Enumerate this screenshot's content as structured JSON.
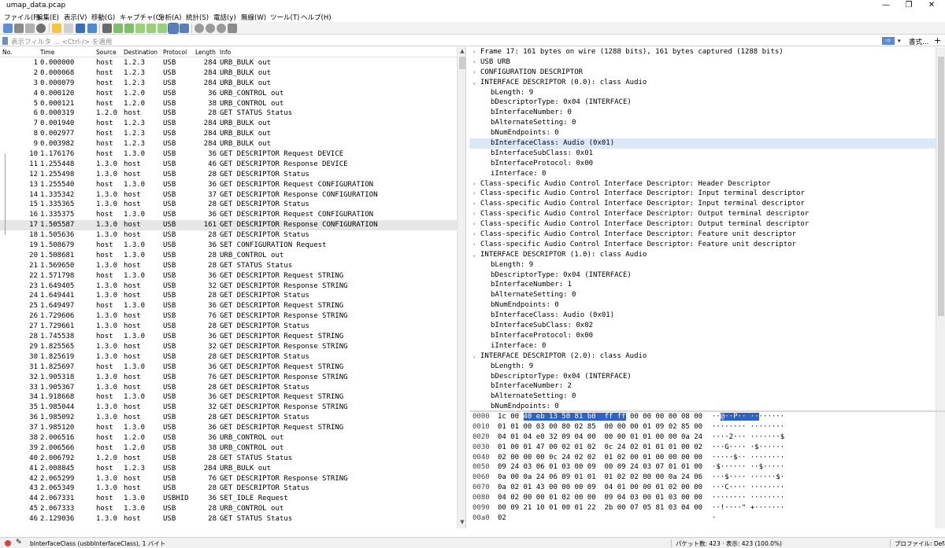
{
  "window": {
    "title": "umap_data.pcap",
    "minimize": "—",
    "restore": "❐",
    "close": "✕"
  },
  "menu": [
    "ファイル(F)",
    "編集(E)",
    "表示(V)",
    "移動(G)",
    "キャプチャ(C)",
    "分析(A)",
    "統計(S)",
    "電話(y)",
    "無線(W)",
    "ツール(T)",
    "ヘルプ(H)"
  ],
  "filter": {
    "placeholder": "表示フィルタ … <Ctrl-/> を適用",
    "apply_glyph": "⇨",
    "dropdown_glyph": "▾",
    "format_label": "書式…",
    "add_glyph": "+"
  },
  "list_columns": [
    "No.",
    "Time",
    "Source",
    "Destination",
    "Protocol",
    "Length",
    "Info"
  ],
  "packets": [
    [
      "1",
      "0.000000",
      "host",
      "1.2.3",
      "USB",
      "284",
      "URB_BULK out"
    ],
    [
      "2",
      "0.000068",
      "host",
      "1.2.3",
      "USB",
      "284",
      "URB_BULK out"
    ],
    [
      "3",
      "0.000079",
      "host",
      "1.2.3",
      "USB",
      "284",
      "URB_BULK out"
    ],
    [
      "4",
      "0.000120",
      "host",
      "1.2.0",
      "USB",
      "36",
      "URB_CONTROL out"
    ],
    [
      "5",
      "0.000121",
      "host",
      "1.2.0",
      "USB",
      "38",
      "URB_CONTROL out"
    ],
    [
      "6",
      "0.000319",
      "1.2.0",
      "host",
      "USB",
      "28",
      "GET STATUS Status"
    ],
    [
      "7",
      "0.001940",
      "host",
      "1.2.3",
      "USB",
      "284",
      "URB_BULK out"
    ],
    [
      "8",
      "0.002977",
      "host",
      "1.2.3",
      "USB",
      "284",
      "URB_BULK out"
    ],
    [
      "9",
      "0.003982",
      "host",
      "1.2.3",
      "USB",
      "284",
      "URB_BULK out"
    ],
    [
      "10",
      "1.176176",
      "host",
      "1.3.0",
      "USB",
      "36",
      "GET DESCRIPTOR Request DEVICE"
    ],
    [
      "11",
      "1.255448",
      "1.3.0",
      "host",
      "USB",
      "46",
      "GET DESCRIPTOR Response DEVICE"
    ],
    [
      "12",
      "1.255498",
      "1.3.0",
      "host",
      "USB",
      "28",
      "GET DESCRIPTOR Status"
    ],
    [
      "13",
      "1.255540",
      "host",
      "1.3.0",
      "USB",
      "36",
      "GET DESCRIPTOR Request CONFIGURATION"
    ],
    [
      "14",
      "1.335342",
      "1.3.0",
      "host",
      "USB",
      "37",
      "GET DESCRIPTOR Response CONFIGURATION"
    ],
    [
      "15",
      "1.335365",
      "1.3.0",
      "host",
      "USB",
      "28",
      "GET DESCRIPTOR Status"
    ],
    [
      "16",
      "1.335375",
      "host",
      "1.3.0",
      "USB",
      "36",
      "GET DESCRIPTOR Request CONFIGURATION"
    ],
    [
      "17",
      "1.505587",
      "1.3.0",
      "host",
      "USB",
      "161",
      "GET DESCRIPTOR Response CONFIGURATION"
    ],
    [
      "18",
      "1.505636",
      "1.3.0",
      "host",
      "USB",
      "28",
      "GET DESCRIPTOR Status"
    ],
    [
      "19",
      "1.508679",
      "host",
      "1.3.0",
      "USB",
      "36",
      "SET CONFIGURATION Request"
    ],
    [
      "20",
      "1.508681",
      "host",
      "1.3.0",
      "USB",
      "28",
      "URB_CONTROL out"
    ],
    [
      "21",
      "1.569650",
      "1.3.0",
      "host",
      "USB",
      "28",
      "GET STATUS Status"
    ],
    [
      "22",
      "1.571798",
      "host",
      "1.3.0",
      "USB",
      "36",
      "GET DESCRIPTOR Request STRING"
    ],
    [
      "23",
      "1.649405",
      "1.3.0",
      "host",
      "USB",
      "32",
      "GET DESCRIPTOR Response STRING"
    ],
    [
      "24",
      "1.649441",
      "1.3.0",
      "host",
      "USB",
      "28",
      "GET DESCRIPTOR Status"
    ],
    [
      "25",
      "1.649497",
      "host",
      "1.3.0",
      "USB",
      "36",
      "GET DESCRIPTOR Request STRING"
    ],
    [
      "26",
      "1.729606",
      "1.3.0",
      "host",
      "USB",
      "76",
      "GET DESCRIPTOR Response STRING"
    ],
    [
      "27",
      "1.729661",
      "1.3.0",
      "host",
      "USB",
      "28",
      "GET DESCRIPTOR Status"
    ],
    [
      "28",
      "1.745538",
      "host",
      "1.3.0",
      "USB",
      "36",
      "GET DESCRIPTOR Request STRING"
    ],
    [
      "29",
      "1.825565",
      "1.3.0",
      "host",
      "USB",
      "32",
      "GET DESCRIPTOR Response STRING"
    ],
    [
      "30",
      "1.825619",
      "1.3.0",
      "host",
      "USB",
      "28",
      "GET DESCRIPTOR Status"
    ],
    [
      "31",
      "1.825697",
      "host",
      "1.3.0",
      "USB",
      "36",
      "GET DESCRIPTOR Request STRING"
    ],
    [
      "32",
      "1.905318",
      "1.3.0",
      "host",
      "USB",
      "76",
      "GET DESCRIPTOR Response STRING"
    ],
    [
      "33",
      "1.905367",
      "1.3.0",
      "host",
      "USB",
      "28",
      "GET DESCRIPTOR Status"
    ],
    [
      "34",
      "1.918668",
      "host",
      "1.3.0",
      "USB",
      "36",
      "GET DESCRIPTOR Request STRING"
    ],
    [
      "35",
      "1.985044",
      "1.3.0",
      "host",
      "USB",
      "32",
      "GET DESCRIPTOR Response STRING"
    ],
    [
      "36",
      "1.985092",
      "1.3.0",
      "host",
      "USB",
      "28",
      "GET DESCRIPTOR Status"
    ],
    [
      "37",
      "1.985120",
      "host",
      "1.3.0",
      "USB",
      "36",
      "GET DESCRIPTOR Request STRING"
    ],
    [
      "38",
      "2.006516",
      "host",
      "1.2.0",
      "USB",
      "36",
      "URB_CONTROL out"
    ],
    [
      "39",
      "2.006566",
      "host",
      "1.2.0",
      "USB",
      "38",
      "URB_CONTROL out"
    ],
    [
      "40",
      "2.006792",
      "1.2.0",
      "host",
      "USB",
      "28",
      "GET STATUS Status"
    ],
    [
      "41",
      "2.008845",
      "host",
      "1.2.3",
      "USB",
      "284",
      "URB_BULK out"
    ],
    [
      "42",
      "2.065299",
      "1.3.0",
      "host",
      "USB",
      "76",
      "GET DESCRIPTOR Response STRING"
    ],
    [
      "43",
      "2.065349",
      "1.3.0",
      "host",
      "USB",
      "28",
      "GET DESCRIPTOR Status"
    ],
    [
      "44",
      "2.067331",
      "host",
      "1.3.0",
      "USBHID",
      "36",
      "SET_IDLE Request"
    ],
    [
      "45",
      "2.067333",
      "host",
      "1.3.0",
      "USB",
      "28",
      "URB_CONTROL out"
    ],
    [
      "46",
      "2.129036",
      "1.3.0",
      "host",
      "USB",
      "28",
      "GET STATUS Status"
    ]
  ],
  "selected_packet": "17",
  "details": [
    {
      "indent": 0,
      "tw": "›",
      "text": "Frame 17: 161 bytes on wire (1288 bits), 161 bytes captured (1288 bits)"
    },
    {
      "indent": 0,
      "tw": "›",
      "text": "USB URB"
    },
    {
      "indent": 0,
      "tw": "›",
      "text": "CONFIGURATION DESCRIPTOR"
    },
    {
      "indent": 0,
      "tw": "⌄",
      "text": "INTERFACE DESCRIPTOR (0.0): class Audio"
    },
    {
      "indent": 1,
      "tw": "",
      "text": "bLength: 9"
    },
    {
      "indent": 1,
      "tw": "",
      "text": "bDescriptorType: 0x04 (INTERFACE)"
    },
    {
      "indent": 1,
      "tw": "",
      "text": "bInterfaceNumber: 0"
    },
    {
      "indent": 1,
      "tw": "",
      "text": "bAlternateSetting: 0"
    },
    {
      "indent": 1,
      "tw": "",
      "text": "bNumEndpoints: 0"
    },
    {
      "indent": 1,
      "tw": "",
      "text": "bInterfaceClass: Audio (0x01)",
      "selected": true
    },
    {
      "indent": 1,
      "tw": "",
      "text": "bInterfaceSubClass: 0x01"
    },
    {
      "indent": 1,
      "tw": "",
      "text": "bInterfaceProtocol: 0x00"
    },
    {
      "indent": 1,
      "tw": "",
      "text": "iInterface: 0"
    },
    {
      "indent": 0,
      "tw": "›",
      "text": "Class-specific Audio Control Interface Descriptor: Header Descriptor"
    },
    {
      "indent": 0,
      "tw": "›",
      "text": "Class-specific Audio Control Interface Descriptor: Input terminal descriptor"
    },
    {
      "indent": 0,
      "tw": "›",
      "text": "Class-specific Audio Control Interface Descriptor: Input terminal descriptor"
    },
    {
      "indent": 0,
      "tw": "›",
      "text": "Class-specific Audio Control Interface Descriptor: Output terminal descriptor"
    },
    {
      "indent": 0,
      "tw": "›",
      "text": "Class-specific Audio Control Interface Descriptor: Output terminal descriptor"
    },
    {
      "indent": 0,
      "tw": "›",
      "text": "Class-specific Audio Control Interface Descriptor: Feature unit descriptor"
    },
    {
      "indent": 0,
      "tw": "›",
      "text": "Class-specific Audio Control Interface Descriptor: Feature unit descriptor"
    },
    {
      "indent": 0,
      "tw": "⌄",
      "text": "INTERFACE DESCRIPTOR (1.0): class Audio"
    },
    {
      "indent": 1,
      "tw": "",
      "text": "bLength: 9"
    },
    {
      "indent": 1,
      "tw": "",
      "text": "bDescriptorType: 0x04 (INTERFACE)"
    },
    {
      "indent": 1,
      "tw": "",
      "text": "bInterfaceNumber: 1"
    },
    {
      "indent": 1,
      "tw": "",
      "text": "bAlternateSetting: 0"
    },
    {
      "indent": 1,
      "tw": "",
      "text": "bNumEndpoints: 0"
    },
    {
      "indent": 1,
      "tw": "",
      "text": "bInterfaceClass: Audio (0x01)"
    },
    {
      "indent": 1,
      "tw": "",
      "text": "bInterfaceSubClass: 0x02"
    },
    {
      "indent": 1,
      "tw": "",
      "text": "bInterfaceProtocol: 0x00"
    },
    {
      "indent": 1,
      "tw": "",
      "text": "iInterface: 0"
    },
    {
      "indent": 0,
      "tw": "⌄",
      "text": "INTERFACE DESCRIPTOR (2.0): class Audio"
    },
    {
      "indent": 1,
      "tw": "",
      "text": "bLength: 9"
    },
    {
      "indent": 1,
      "tw": "",
      "text": "bDescriptorType: 0x04 (INTERFACE)"
    },
    {
      "indent": 1,
      "tw": "",
      "text": "bInterfaceNumber: 2"
    },
    {
      "indent": 1,
      "tw": "",
      "text": "bAlternateSetting: 0"
    },
    {
      "indent": 1,
      "tw": "",
      "text": "bNumEndpoints: 0"
    }
  ],
  "bytes": [
    {
      "off": "0000",
      "pre": "1c 00 ",
      "hl": "40 eb 13 50 81 b0  ff ff",
      "post": " 00 00 00 00 08 00",
      "apre": "··",
      "ahl": "@··P·· ··",
      "apost": "······"
    },
    {
      "off": "0010",
      "pre": "01 01 00 03 00 80 02 85  00 00 00 01 09 02 85 00",
      "hl": "",
      "post": "",
      "apre": "········ ········",
      "ahl": "",
      "apost": ""
    },
    {
      "off": "0020",
      "pre": "04 01 04 e0 32 09 04 00  00 00 01 01 00 00 0a 24",
      "hl": "",
      "post": "",
      "apre": "····2··· ·······$",
      "ahl": "",
      "apost": ""
    },
    {
      "off": "0030",
      "pre": "01 00 01 47 00 02 01 02  0c 24 02 01 01 01 00 02",
      "hl": "",
      "post": "",
      "apre": "···G···· ·$······",
      "ahl": "",
      "apost": ""
    },
    {
      "off": "0040",
      "pre": "02 00 00 00 0c 24 02 02  01 02 00 01 00 00 00 00",
      "hl": "",
      "post": "",
      "apre": "·····$·· ········",
      "ahl": "",
      "apost": ""
    },
    {
      "off": "0050",
      "pre": "09 24 03 06 01 03 00 09  00 09 24 03 07 01 01 00",
      "hl": "",
      "post": "",
      "apre": "·$······ ··$·····",
      "ahl": "",
      "apost": ""
    },
    {
      "off": "0060",
      "pre": "0a 00 0a 24 06 09 01 01  01 02 02 00 00 0a 24 06",
      "hl": "",
      "post": "",
      "apre": "···$···· ······$·",
      "ahl": "",
      "apost": ""
    },
    {
      "off": "0070",
      "pre": "0a 02 01 43 00 00 00 09  04 01 00 00 01 02 00 00",
      "hl": "",
      "post": "",
      "apre": "···C···· ········",
      "ahl": "",
      "apost": ""
    },
    {
      "off": "0080",
      "pre": "04 02 00 00 01 02 00 00  09 04 03 00 01 03 00 00",
      "hl": "",
      "post": "",
      "apre": "········ ········",
      "ahl": "",
      "apost": ""
    },
    {
      "off": "0090",
      "pre": "00 09 21 10 01 00 01 22  2b 00 07 05 81 03 04 00",
      "hl": "",
      "post": "",
      "apre": "··!····\" +·······",
      "ahl": "",
      "apost": ""
    },
    {
      "off": "00a0",
      "pre": "02",
      "hl": "",
      "post": "",
      "apre": "·",
      "ahl": "",
      "apost": ""
    }
  ],
  "status": {
    "field": "bInterfaceClass (usbbInterfaceClass), 1 バイト",
    "counts": "パケット数: 423 · 表示: 423 (100.0%)",
    "profile": "プロファイル: Default"
  },
  "colors": {
    "selected_row": "#e6e6e6",
    "selected_detail": "#dce8f7",
    "hex_highlight": "#2e62c6",
    "capture_led": "#e04040"
  }
}
